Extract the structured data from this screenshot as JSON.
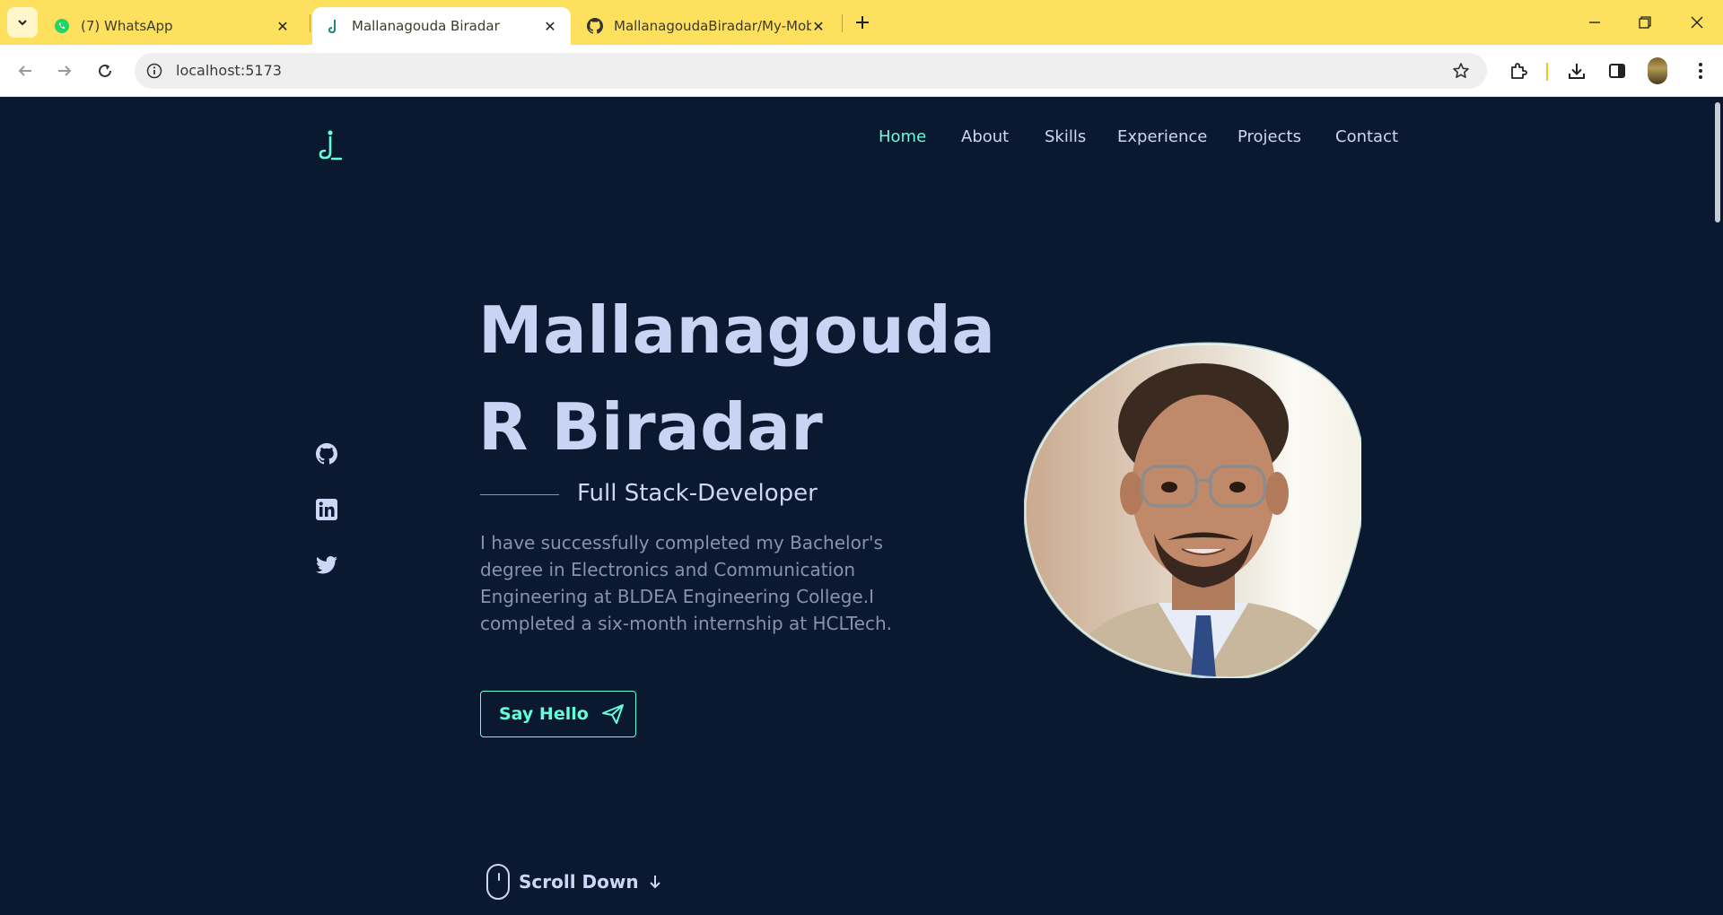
{
  "browser": {
    "tabs": [
      {
        "title": "(7) WhatsApp",
        "icon": "whatsapp-icon"
      },
      {
        "title": "Mallanagouda Biradar",
        "icon": "site-logo-icon",
        "active": true
      },
      {
        "title": "MallanagoudaBiradar/My-Mobi",
        "icon": "github-icon"
      }
    ],
    "url": "localhost:5173",
    "accent": "#fde15e"
  },
  "nav": {
    "items": [
      "Home",
      "About",
      "Skills",
      "Experience",
      "Projects",
      "Contact"
    ],
    "active": "Home"
  },
  "social": [
    "github-icon",
    "linkedin-icon",
    "twitter-icon"
  ],
  "hero": {
    "name_line1": "Mallanagouda",
    "name_line2": "R Biradar",
    "role": "Full Stack-Developer",
    "description": "I have successfully completed my Bachelor's degree in Electronics and Communication Engineering at BLDEA Engineering College.I completed a six-month internship at HCLTech.",
    "cta": "Say Hello",
    "scroll_label": "Scroll Down"
  },
  "colors": {
    "background": "#0a192f",
    "accent": "#64ffda",
    "heading": "#ccd6f6",
    "body_text": "#8892b0"
  }
}
